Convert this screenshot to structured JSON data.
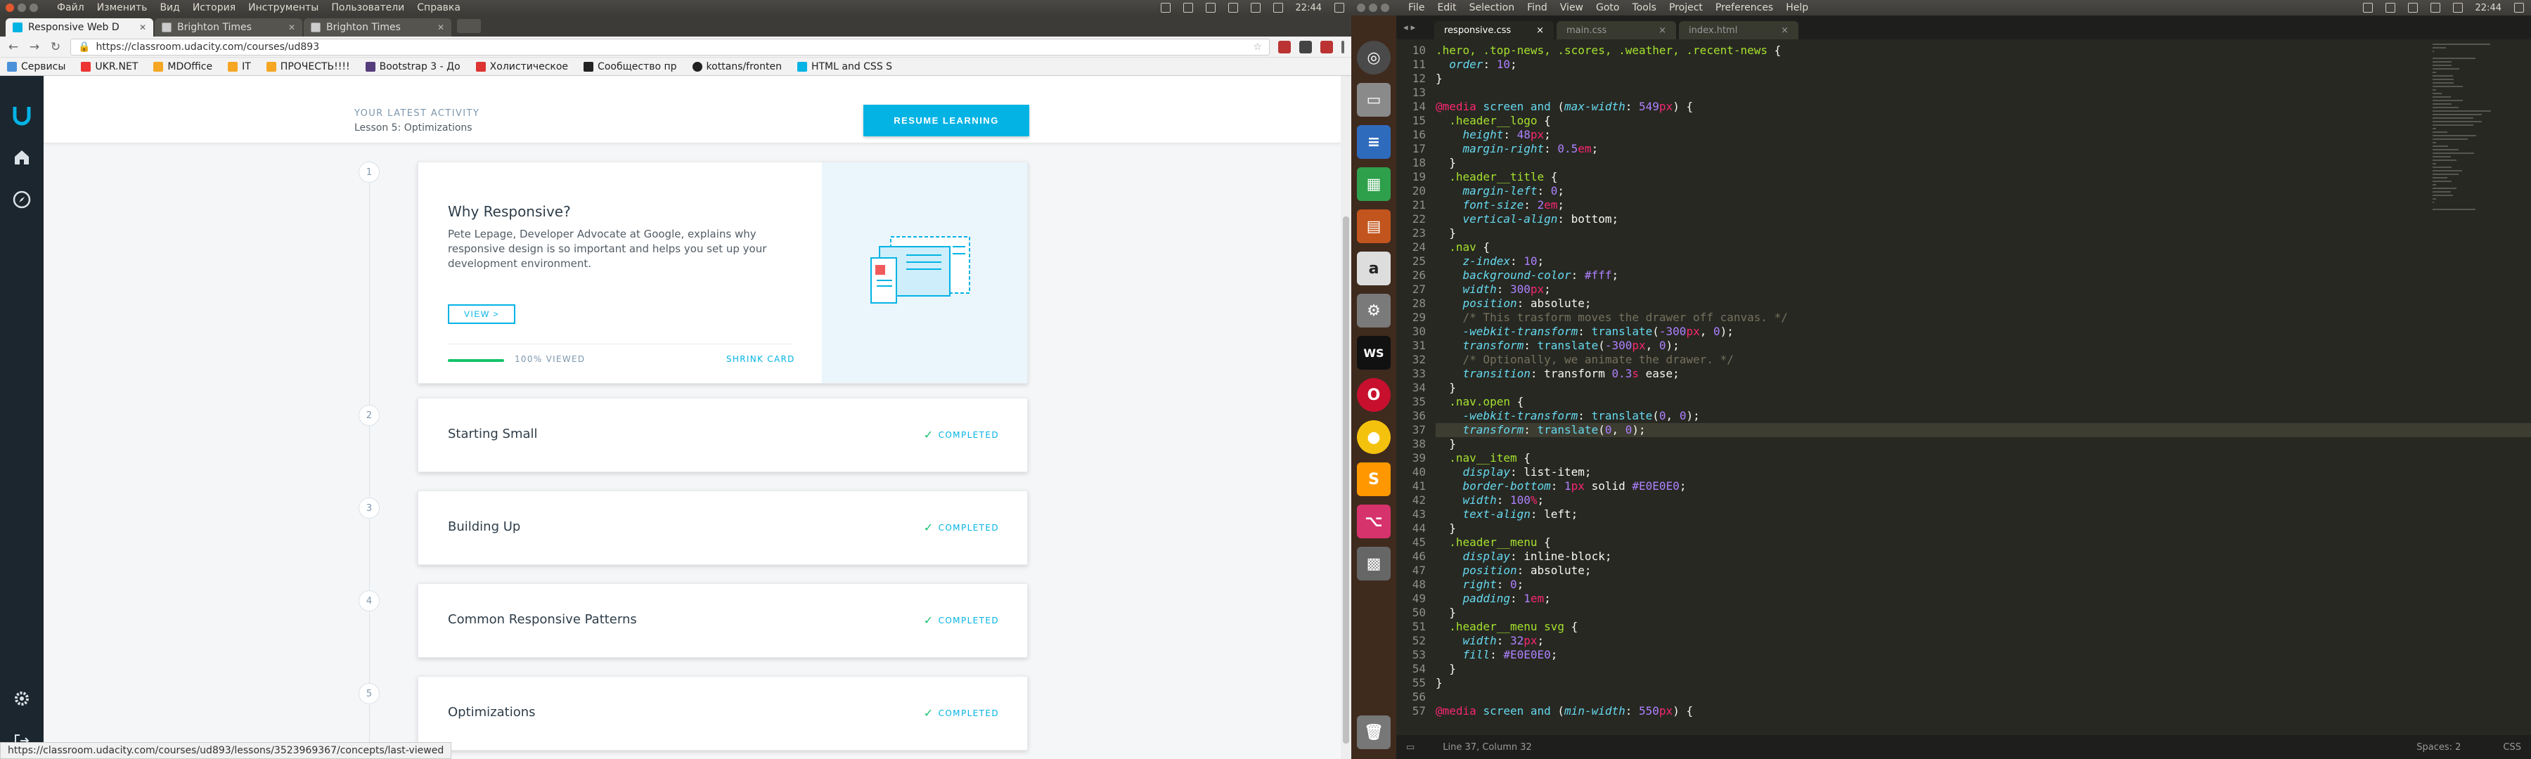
{
  "left_menubar": {
    "items": [
      "Файл",
      "Изменить",
      "Вид",
      "История",
      "Инструменты",
      "Пользователи",
      "Справка"
    ]
  },
  "right_menubar": {
    "items": [
      "File",
      "Edit",
      "Selection",
      "Find",
      "View",
      "Goto",
      "Tools",
      "Project",
      "Preferences",
      "Help"
    ]
  },
  "system_tray": {
    "time": "22:44"
  },
  "browser": {
    "tabs": [
      {
        "label": "Responsive Web D",
        "active": true
      },
      {
        "label": "Brighton Times",
        "active": false
      },
      {
        "label": "Brighton Times",
        "active": false
      }
    ],
    "url": "https://classroom.udacity.com/courses/ud893",
    "bookmarks": [
      "Сервисы",
      "UKR.NET",
      "MDOffice",
      "IT",
      "ПРОЧЕСТЬ!!!!",
      "Bootstrap 3 - До",
      "Холистическое",
      "Сообщество пр",
      "kottans/fronten",
      "HTML and CSS S"
    ],
    "status_url": "https://classroom.udacity.com/courses/ud893/lessons/3523969367/concepts/last-viewed"
  },
  "activity": {
    "label": "YOUR LATEST ACTIVITY",
    "lesson": "Lesson 5: Optimizations",
    "resume_button": "RESUME LEARNING"
  },
  "lessons": [
    {
      "number": "1",
      "title": "Why Responsive?",
      "description": "Pete Lepage, Developer Advocate at Google, explains why responsive design is so important and helps you set up your development environment.",
      "view_button": "VIEW >",
      "progress": 1.0,
      "progress_text": "100% VIEWED",
      "shrink": "SHRINK CARD"
    },
    {
      "number": "2",
      "title": "Starting Small",
      "status": "COMPLETED"
    },
    {
      "number": "3",
      "title": "Building Up",
      "status": "COMPLETED"
    },
    {
      "number": "4",
      "title": "Common Responsive Patterns",
      "status": "COMPLETED"
    },
    {
      "number": "5",
      "title": "Optimizations",
      "status": "COMPLETED"
    }
  ],
  "editor": {
    "tabs": [
      {
        "label": "responsive.css",
        "active": true
      },
      {
        "label": "main.css",
        "active": false
      },
      {
        "label": "index.html",
        "active": false
      }
    ],
    "status_left": "Line 37, Column 32",
    "status_spaces": "Spaces: 2",
    "status_syntax": "CSS",
    "line_numbers": [
      "10",
      "11",
      "12",
      "13",
      "14",
      "15",
      "16",
      "17",
      "18",
      "19",
      "20",
      "21",
      "22",
      "23",
      "24",
      "25",
      "26",
      "27",
      "28",
      "29",
      "30",
      "31",
      "32",
      "33",
      "34",
      "35",
      "36",
      "37",
      "38",
      "39",
      "40",
      "41",
      "42",
      "43",
      "44",
      "45",
      "46",
      "47",
      "48",
      "49",
      "50",
      "51",
      "52",
      "53",
      "54",
      "55",
      "56",
      "57"
    ],
    "code_lines": [
      ".hero, .top-news, .scores, .weather, .recent-news {",
      "  order: 10;",
      "}",
      "",
      "@media screen and (max-width: 549px) {",
      "  .header__logo {",
      "    height: 48px;",
      "    margin-right: 0.5em;",
      "  }",
      "  .header__title {",
      "    margin-left: 0;",
      "    font-size: 2em;",
      "    vertical-align: bottom;",
      "  }",
      "  .nav {",
      "    z-index: 10;",
      "    background-color: #fff;",
      "    width: 300px;",
      "    position: absolute;",
      "    /* This trasform moves the drawer off canvas. */",
      "    -webkit-transform: translate(-300px, 0);",
      "    transform: translate(-300px, 0);",
      "    /* Optionally, we animate the drawer. */",
      "    transition: transform 0.3s ease;",
      "  }",
      "  .nav.open {",
      "    -webkit-transform: translate(0, 0);",
      "    transform: translate(0, 0);",
      "  }",
      "  .nav__item {",
      "    display: list-item;",
      "    border-bottom: 1px solid #E0E0E0;",
      "    width: 100%;",
      "    text-align: left;",
      "  }",
      "  .header__menu {",
      "    display: inline-block;",
      "    position: absolute;",
      "    right: 0;",
      "    padding: 1em;",
      "  }",
      "  .header__menu svg {",
      "    width: 32px;",
      "    fill: #E0E0E0;",
      "  }",
      "}",
      "",
      "@media screen and (min-width: 550px) {"
    ]
  },
  "colors": {
    "accent": "#02b3e4",
    "success": "#15c26b",
    "sidebar": "#1c262f",
    "editor_bg": "#272822"
  },
  "launcher_icons": [
    "ubuntu-dash-icon",
    "files-icon",
    "writer-icon",
    "calc-icon",
    "impress-icon",
    "amazon-icon",
    "settings-icon",
    "webstorm-icon",
    "opera-icon",
    "chrome-icon",
    "sublime-icon",
    "git-icon",
    "calculator-icon",
    "trash-icon"
  ]
}
